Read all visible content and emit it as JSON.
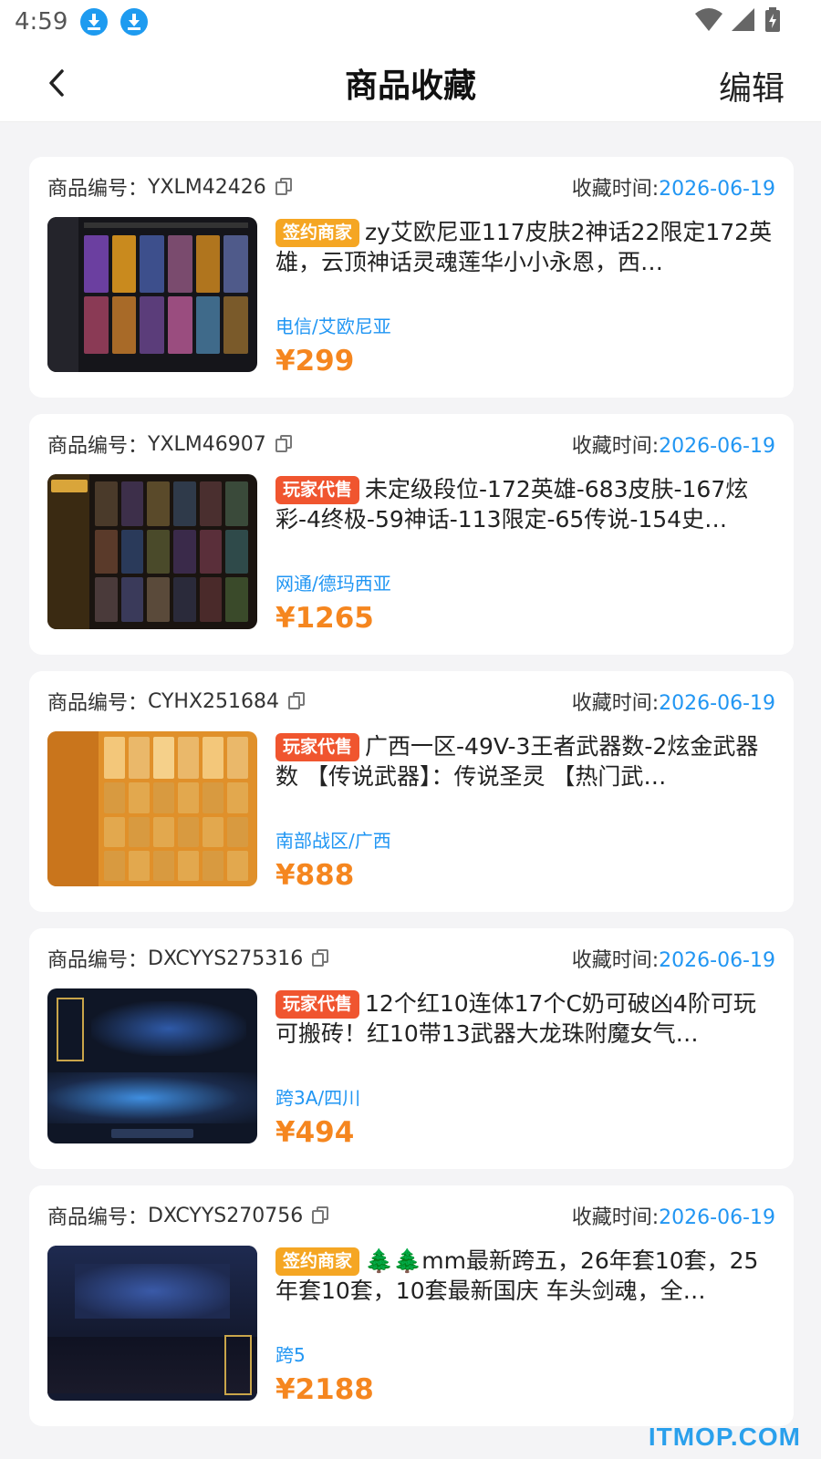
{
  "status_bar": {
    "time": "4:59"
  },
  "nav": {
    "title": "商品收藏",
    "edit_label": "编辑"
  },
  "labels": {
    "code_prefix": "商品编号：",
    "time_prefix": "收藏时间:"
  },
  "colors": {
    "accent_blue": "#2196f3",
    "price_orange": "#f5861f",
    "badge_sign": "#f5a623",
    "badge_player": "#f0552f"
  },
  "items": [
    {
      "code": "YXLM42426",
      "time": "2026-06-19",
      "badge": "签约商家",
      "badge_type": "sign",
      "title": "zy艾欧尼亚117皮肤2神话22限定172英雄，云顶神话灵魂莲华小小永恩，西…",
      "region": "电信/艾欧尼亚",
      "price": "¥299",
      "thumb_theme": "dark"
    },
    {
      "code": "YXLM46907",
      "time": "2026-06-19",
      "badge": "玩家代售",
      "badge_type": "player",
      "title": "未定级段位-172英雄-683皮肤-167炫彩-4终极-59神话-113限定-65传说-154史…",
      "region": "网通/德玛西亚",
      "price": "¥1265",
      "thumb_theme": "gold"
    },
    {
      "code": "CYHX251684",
      "time": "2026-06-19",
      "badge": "玩家代售",
      "badge_type": "player",
      "title": "广西一区-49V-3王者武器数-2炫金武器数 【传说武器】：传说圣灵 【热门武…",
      "region": "南部战区/广西",
      "price": "¥888",
      "thumb_theme": "orange"
    },
    {
      "code": "DXCYYS275316",
      "time": "2026-06-19",
      "badge": "玩家代售",
      "badge_type": "player",
      "title": "12个红10连体17个C奶可破凶4阶可玩可搬砖！红10带13武器大龙珠附魔女气…",
      "region": "跨3A/四川",
      "price": "¥494",
      "thumb_theme": "blue"
    },
    {
      "code": "DXCYYS270756",
      "time": "2026-06-19",
      "badge": "签约商家",
      "badge_type": "sign",
      "title": "🌲🌲mm最新跨五，26年套10套，25年套10套，10套最新国庆 车头剑魂，全…",
      "region": "跨5",
      "price": "¥2188",
      "thumb_theme": "navy"
    }
  ],
  "watermark": "ITMOP.COM"
}
